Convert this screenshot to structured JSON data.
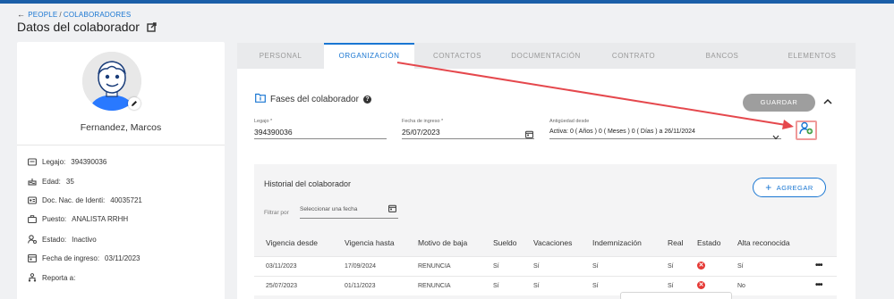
{
  "breadcrumb": {
    "root": "PEOPLE",
    "current": "COLABORADORES"
  },
  "page": {
    "title": "Datos del colaborador"
  },
  "profile": {
    "name": "Fernandez, Marcos",
    "info": [
      {
        "icon": "id-card-icon",
        "label": "Legajo:",
        "value": "394390036"
      },
      {
        "icon": "cake-icon",
        "label": "Edad:",
        "value": "35"
      },
      {
        "icon": "id-document-icon",
        "label": "Doc. Nac. de Identi:",
        "value": "40035721"
      },
      {
        "icon": "briefcase-icon",
        "label": "Puesto:",
        "value": "ANALISTA RRHH"
      },
      {
        "icon": "user-status-icon",
        "label": "Estado:",
        "value": "Inactivo"
      },
      {
        "icon": "calendar-icon",
        "label": "Fecha de ingreso:",
        "value": "03/11/2023"
      },
      {
        "icon": "org-chart-icon",
        "label": "Reporta a:",
        "value": ""
      }
    ]
  },
  "tabs": [
    "PERSONAL",
    "ORGANIZACIÓN",
    "CONTACTOS",
    "DOCUMENTACIÓN",
    "CONTRATO",
    "BANCOS",
    "ELEMENTOS"
  ],
  "active_tab": "ORGANIZACIÓN",
  "fases": {
    "title": "Fases del colaborador",
    "help_symbol": "?",
    "save_label": "GUARDAR",
    "legajo": {
      "label": "Legajo *",
      "value": "394390036"
    },
    "fecha_ingreso": {
      "label": "Fecha de ingreso *",
      "value": "25/07/2023"
    },
    "antiguedad": {
      "label": "Antigüedad desde",
      "value": "Activa: 0 ( Años ) 0 ( Meses ) 0 ( Días ) a 26/11/2024"
    }
  },
  "historial": {
    "title": "Historial del colaborador",
    "add_label": "AGREGAR",
    "filter_label": "Filtrar por",
    "filter_placeholder": "Seleccionar una fecha",
    "columns": [
      "Vigencia desde",
      "Vigencia hasta",
      "Motivo de baja",
      "Sueldo",
      "Vacaciones",
      "Indemnización",
      "Real",
      "Estado",
      "Alta reconocida"
    ],
    "rows": [
      {
        "desde": "03/11/2023",
        "hasta": "17/09/2024",
        "motivo": "RENUNCIA",
        "sueldo": "Sí",
        "vacaciones": "Sí",
        "indemnizacion": "Sí",
        "real": "Sí",
        "estado": "✕",
        "alta": "Sí"
      },
      {
        "desde": "25/07/2023",
        "hasta": "01/11/2023",
        "motivo": "RENUNCIA",
        "sueldo": "Sí",
        "vacaciones": "Sí",
        "indemnizacion": "Sí",
        "real": "Sí",
        "estado": "✕",
        "alta": "No"
      }
    ],
    "row_menu_symbol": "•••"
  },
  "colors": {
    "accent": "#1976d2",
    "annotation": "#e53935",
    "disabled_button": "#9e9e9e",
    "status_error": "#e53935"
  }
}
